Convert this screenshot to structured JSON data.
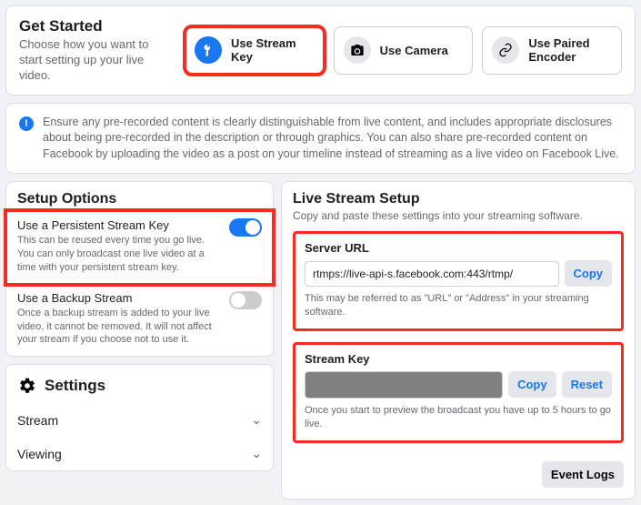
{
  "getStarted": {
    "title": "Get Started",
    "desc": "Choose how you want to start setting up your live video.",
    "options": [
      {
        "label": "Use Stream Key"
      },
      {
        "label": "Use Camera"
      },
      {
        "label": "Use Paired Encoder"
      }
    ]
  },
  "infoBanner": "Ensure any pre-recorded content is clearly distinguishable from live content, and includes appropriate disclosures about being pre-recorded in the description or through graphics. You can also share pre-recorded content on Facebook by uploading the video as a post on your timeline instead of streaming as a live video on Facebook Live.",
  "setupOptions": {
    "title": "Setup Options",
    "persistent": {
      "title": "Use a Persistent Stream Key",
      "desc": "This can be reused every time you go live. You can only broadcast one live video at a time with your persistent stream key.",
      "on": true
    },
    "backup": {
      "title": "Use a Backup Stream",
      "desc": "Once a backup stream is added to your live video, it cannot be removed. It will not affect your stream if you choose not to use it.",
      "on": false
    }
  },
  "settings": {
    "title": "Settings",
    "items": [
      "Stream",
      "Viewing"
    ]
  },
  "liveStreamSetup": {
    "title": "Live Stream Setup",
    "sub": "Copy and paste these settings into your streaming software.",
    "serverUrl": {
      "label": "Server URL",
      "value": "rtmps://live-api-s.facebook.com:443/rtmp/",
      "hint": "This may be referred to as \"URL\" or \"Address\" in your streaming software.",
      "copy": "Copy"
    },
    "streamKey": {
      "label": "Stream Key",
      "hint": "Once you start to preview the broadcast you have up to 5 hours to go live.",
      "copy": "Copy",
      "reset": "Reset"
    },
    "eventLogs": "Event Logs"
  }
}
